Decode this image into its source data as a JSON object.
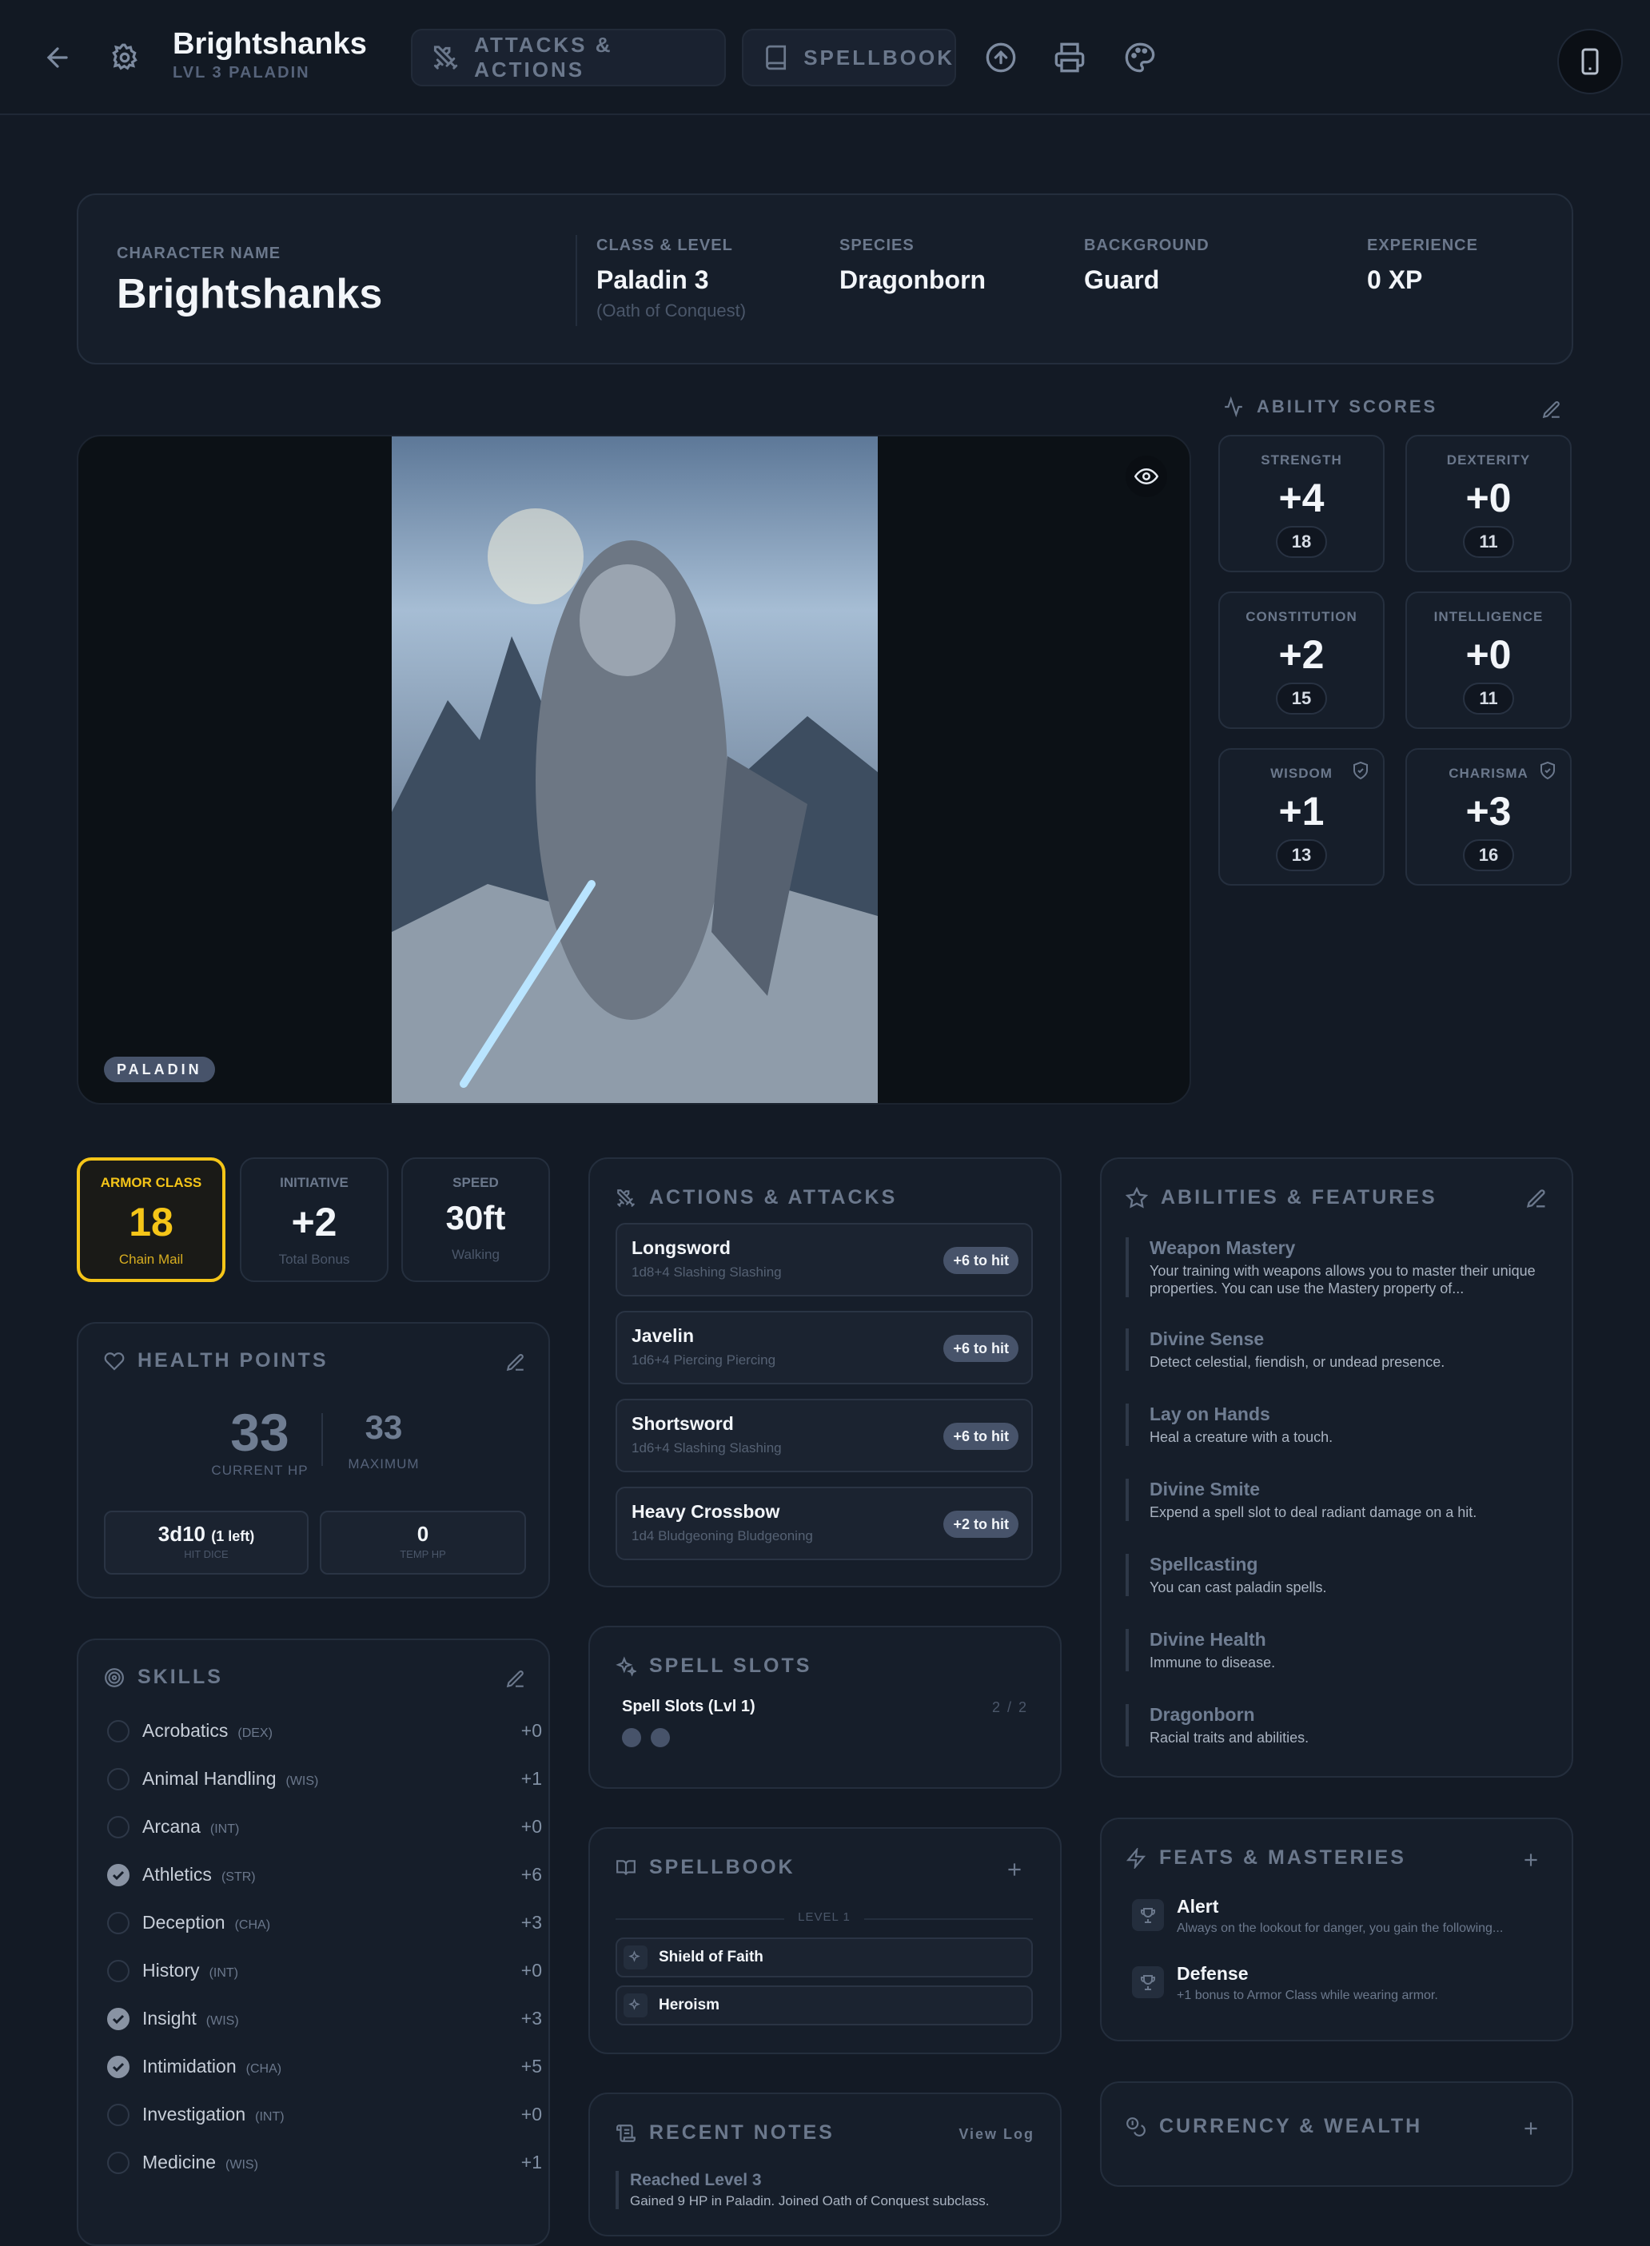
{
  "header": {
    "name": "Brightshanks",
    "subtitle": "LVL 3 PALADIN",
    "tab_attacks": "ATTACKS & ACTIONS",
    "tab_spellbook": "SPELLBOOK"
  },
  "identity": {
    "name_label": "CHARACTER NAME",
    "name": "Brightshanks",
    "class_label": "CLASS & LEVEL",
    "class": "Paladin 3",
    "subclass": "(Oath of Conquest)",
    "species_label": "SPECIES",
    "species": "Dragonborn",
    "background_label": "BACKGROUND",
    "background": "Guard",
    "xp_label": "EXPERIENCE",
    "xp": "0 XP"
  },
  "portrait": {
    "badge": "PALADIN"
  },
  "abilities": {
    "title": "ABILITY SCORES",
    "items": [
      {
        "name": "STRENGTH",
        "mod": "+4",
        "score": "18"
      },
      {
        "name": "DEXTERITY",
        "mod": "+0",
        "score": "11"
      },
      {
        "name": "CONSTITUTION",
        "mod": "+2",
        "score": "15"
      },
      {
        "name": "INTELLIGENCE",
        "mod": "+0",
        "score": "11"
      },
      {
        "name": "WISDOM",
        "mod": "+1",
        "score": "13"
      },
      {
        "name": "CHARISMA",
        "mod": "+3",
        "score": "16"
      }
    ]
  },
  "combat": {
    "ac_label": "ARMOR CLASS",
    "ac": "18",
    "ac_sub": "Chain Mail",
    "init_label": "INITIATIVE",
    "init": "+2",
    "init_sub": "Total Bonus",
    "speed_label": "SPEED",
    "speed": "30ft",
    "speed_sub": "Walking"
  },
  "hp": {
    "title": "HEALTH POINTS",
    "current": "33",
    "current_label": "CURRENT HP",
    "max": "33",
    "max_label": "MAXIMUM",
    "hit_dice": "3d10",
    "hit_dice_left": "(1 left)",
    "hit_dice_label": "HIT DICE",
    "temp": "0",
    "temp_label": "TEMP HP"
  },
  "skills": {
    "title": "SKILLS",
    "items": [
      {
        "name": "Acrobatics",
        "ab": "(DEX)",
        "val": "+0",
        "prof": false
      },
      {
        "name": "Animal Handling",
        "ab": "(WIS)",
        "val": "+1",
        "prof": false
      },
      {
        "name": "Arcana",
        "ab": "(INT)",
        "val": "+0",
        "prof": false
      },
      {
        "name": "Athletics",
        "ab": "(STR)",
        "val": "+6",
        "prof": true
      },
      {
        "name": "Deception",
        "ab": "(CHA)",
        "val": "+3",
        "prof": false
      },
      {
        "name": "History",
        "ab": "(INT)",
        "val": "+0",
        "prof": false
      },
      {
        "name": "Insight",
        "ab": "(WIS)",
        "val": "+3",
        "prof": true
      },
      {
        "name": "Intimidation",
        "ab": "(CHA)",
        "val": "+5",
        "prof": true
      },
      {
        "name": "Investigation",
        "ab": "(INT)",
        "val": "+0",
        "prof": false
      },
      {
        "name": "Medicine",
        "ab": "(WIS)",
        "val": "+1",
        "prof": false
      }
    ]
  },
  "attacks": {
    "title": "ACTIONS & ATTACKS",
    "items": [
      {
        "name": "Longsword",
        "detail": "1d8+4 Slashing Slashing",
        "hit": "+6 to hit"
      },
      {
        "name": "Javelin",
        "detail": "1d6+4 Piercing Piercing",
        "hit": "+6 to hit"
      },
      {
        "name": "Shortsword",
        "detail": "1d6+4 Slashing Slashing",
        "hit": "+6 to hit"
      },
      {
        "name": "Heavy Crossbow",
        "detail": "1d4 Bludgeoning Bludgeoning",
        "hit": "+2 to hit"
      }
    ]
  },
  "spell_slots": {
    "title": "SPELL SLOTS",
    "row_label": "Spell Slots (Lvl 1)",
    "count": "2 / 2"
  },
  "spellbook": {
    "title": "SPELLBOOK",
    "level_label": "LEVEL 1",
    "spells": [
      "Shield of Faith",
      "Heroism"
    ]
  },
  "notes": {
    "title": "RECENT NOTES",
    "view_log": "View Log",
    "latest_title": "Reached Level 3",
    "latest_text": "Gained 9 HP in Paladin. Joined Oath of Conquest subclass."
  },
  "features": {
    "title": "ABILITIES & FEATURES",
    "items": [
      {
        "name": "Weapon Mastery",
        "desc": "Your training with weapons allows you to master their unique properties. You can use the Mastery property of..."
      },
      {
        "name": "Divine Sense",
        "desc": "Detect celestial, fiendish, or undead presence."
      },
      {
        "name": "Lay on Hands",
        "desc": "Heal a creature with a touch."
      },
      {
        "name": "Divine Smite",
        "desc": "Expend a spell slot to deal radiant damage on a hit."
      },
      {
        "name": "Spellcasting",
        "desc": "You can cast paladin spells."
      },
      {
        "name": "Divine Health",
        "desc": "Immune to disease."
      },
      {
        "name": "Dragonborn",
        "desc": "Racial traits and abilities."
      }
    ]
  },
  "feats": {
    "title": "FEATS & MASTERIES",
    "items": [
      {
        "name": "Alert",
        "desc": "Always on the lookout for danger, you gain the following..."
      },
      {
        "name": "Defense",
        "desc": "+1 bonus to Armor Class while wearing armor."
      }
    ]
  },
  "currency": {
    "title": "CURRENCY & WEALTH"
  },
  "colors": {
    "background": "#131a25",
    "card": "#161e2a",
    "accent_gold": "#f5c518"
  }
}
